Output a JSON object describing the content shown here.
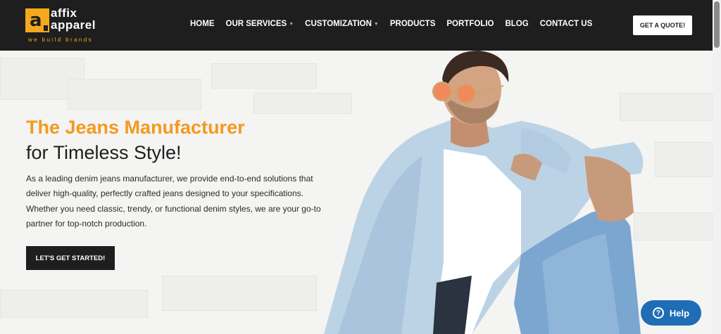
{
  "header": {
    "logo": {
      "word1": "affix",
      "word2": "apparel",
      "tagline": "we build brands",
      "mark_letter": "a"
    },
    "nav": [
      {
        "label": "HOME",
        "has_dropdown": false
      },
      {
        "label": "OUR SERVICES",
        "has_dropdown": true
      },
      {
        "label": "CUSTOMIZATION",
        "has_dropdown": true
      },
      {
        "label": "PRODUCTS",
        "has_dropdown": false
      },
      {
        "label": "PORTFOLIO",
        "has_dropdown": false
      },
      {
        "label": "BLOG",
        "has_dropdown": false
      },
      {
        "label": "CONTACT US",
        "has_dropdown": false
      }
    ],
    "quote_button": "GET A QUOTE!"
  },
  "hero": {
    "title_line1": "The Jeans Manufacturer",
    "title_line2": "for Timeless Style!",
    "description": "As a leading denim jeans manufacturer, we provide end-to-end solutions that deliver high-quality, perfectly crafted jeans designed to your specifications. Whether you need classic, trendy, or functional denim styles, we are your go-to partner for top-notch production.",
    "cta_button": "LET'S GET STARTED!"
  },
  "help_widget": {
    "label": "Help",
    "icon": "question-icon"
  },
  "colors": {
    "header_bg": "#1e1e1e",
    "brand_orange": "#f39a1f",
    "help_blue": "#1f6db4"
  }
}
